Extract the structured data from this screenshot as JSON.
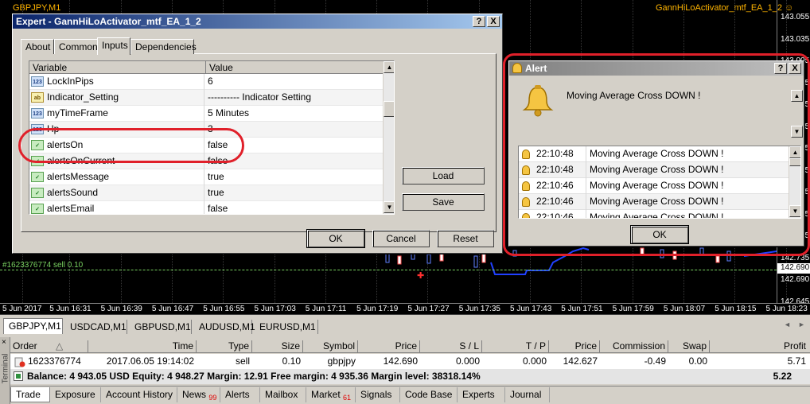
{
  "chart": {
    "symbol_title": "GBPJPY,M1",
    "ea_title": "GannHiLoActivator_mtf_EA_1_2",
    "smiley": "☺",
    "price_ticks": [
      "143.055",
      "143.035",
      "143.005",
      "142.975",
      "142.945",
      "142.915",
      "142.885",
      "142.855",
      "142.825",
      "142.795",
      "142.765",
      "142.735",
      "142.690",
      "142.645"
    ],
    "time_ticks": [
      "5 Jun 2017",
      "5 Jun 16:31",
      "5 Jun 16:39",
      "5 Jun 16:47",
      "5 Jun 16:55",
      "5 Jun 17:03",
      "5 Jun 17:11",
      "5 Jun 17:19",
      "5 Jun 17:27",
      "5 Jun 17:35",
      "5 Jun 17:43",
      "5 Jun 17:51",
      "5 Jun 17:59",
      "5 Jun 18:07",
      "5 Jun 18:15",
      "5 Jun 18:23"
    ],
    "order_label": "#1623376774 sell 0.10",
    "current_price_label": "142.690"
  },
  "expert": {
    "title": "Expert - GannHiLoActivator_mtf_EA_1_2",
    "help_btn": "?",
    "close_btn": "X",
    "tabs": [
      "About",
      "Common",
      "Inputs",
      "Dependencies"
    ],
    "active_tab": "Inputs",
    "grid": {
      "col_variable": "Variable",
      "col_value": "Value",
      "rows": [
        {
          "icon": "123",
          "name": "LockInPips",
          "value": "6"
        },
        {
          "icon": "ab",
          "name": "Indicator_Setting",
          "value": "---------- Indicator Setting"
        },
        {
          "icon": "123",
          "name": "myTimeFrame",
          "value": "5 Minutes"
        },
        {
          "icon": "123",
          "name": "Hp",
          "value": "3"
        },
        {
          "icon": "bool",
          "name": "alertsOn",
          "value": "false"
        },
        {
          "icon": "bool",
          "name": "alertsOnCurrent",
          "value": "false"
        },
        {
          "icon": "bool",
          "name": "alertsMessage",
          "value": "true"
        },
        {
          "icon": "bool",
          "name": "alertsSound",
          "value": "true"
        },
        {
          "icon": "bool",
          "name": "alertsEmail",
          "value": "false"
        }
      ]
    },
    "load": "Load",
    "save": "Save",
    "ok": "OK",
    "cancel": "Cancel",
    "reset": "Reset"
  },
  "alert": {
    "title": "Alert",
    "help_btn": "?",
    "close_btn": "X",
    "message": "Moving Average Cross DOWN !",
    "rows": [
      {
        "time": "22:10:48",
        "text": "Moving Average Cross DOWN !"
      },
      {
        "time": "22:10:48",
        "text": "Moving Average Cross DOWN !"
      },
      {
        "time": "22:10:46",
        "text": "Moving Average Cross DOWN !"
      },
      {
        "time": "22:10:46",
        "text": "Moving Average Cross DOWN !"
      },
      {
        "time": "22:10:46",
        "text": "Moving Average Cross DOWN !"
      }
    ],
    "ok": "OK"
  },
  "symbol_tabs": [
    "GBPJPY,M1",
    "USDCAD,M1",
    "GBPUSD,M1",
    "AUDUSD,M1",
    "EURUSD,M1"
  ],
  "terminal": {
    "side_label": "Terminal",
    "close": "×",
    "headers": {
      "order": "Order",
      "sort": "△",
      "time": "Time",
      "type": "Type",
      "size": "Size",
      "symbol": "Symbol",
      "price": "Price",
      "sl": "S / L",
      "tp": "T / P",
      "price2": "Price",
      "commission": "Commission",
      "swap": "Swap",
      "profit": "Profit"
    },
    "row": {
      "order": "1623376774",
      "time": "2017.06.05 19:14:02",
      "type": "sell",
      "size": "0.10",
      "symbol": "gbpjpy",
      "price": "142.690",
      "sl": "0.000",
      "tp": "0.000",
      "price2": "142.627",
      "commission": "-0.49",
      "swap": "0.00",
      "profit": "5.71"
    },
    "balance_text": "Balance: 4 943.05 USD  Equity: 4 948.27  Margin: 12.91  Free margin: 4 935.36  Margin level: 38318.14%",
    "balance_profit": "5.22",
    "tabs": [
      {
        "label": "Trade",
        "badge": ""
      },
      {
        "label": "Exposure",
        "badge": ""
      },
      {
        "label": "Account History",
        "badge": ""
      },
      {
        "label": "News",
        "badge": "99"
      },
      {
        "label": "Alerts",
        "badge": ""
      },
      {
        "label": "Mailbox",
        "badge": ""
      },
      {
        "label": "Market",
        "badge": "61"
      },
      {
        "label": "Signals",
        "badge": ""
      },
      {
        "label": "Code Base",
        "badge": ""
      },
      {
        "label": "Experts",
        "badge": ""
      },
      {
        "label": "Journal",
        "badge": ""
      }
    ]
  },
  "colors": {
    "chart_bg": "#000000",
    "title_orange": "#ffb400",
    "order_line": "#78d060",
    "annotation": "#e0202a",
    "indicator_blue": "#2040ff"
  }
}
